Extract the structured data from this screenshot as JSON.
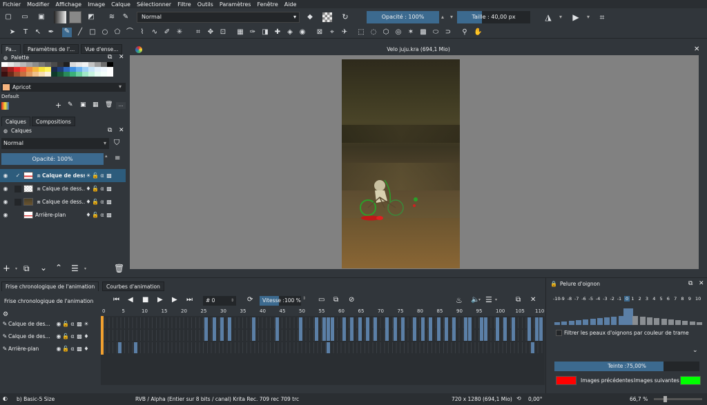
{
  "menu": [
    "Fichier",
    "Modifier",
    "Affichage",
    "Image",
    "Calque",
    "Sélectionner",
    "Filtre",
    "Outils",
    "Paramètres",
    "Fenêtre",
    "Aide"
  ],
  "toolbar": {
    "blend_mode": "Normal",
    "opacity_label": "Opacité : 100%",
    "size_label": "Taille : 40,00 px"
  },
  "left_tabs": [
    "Pa...",
    "Paramètres de l'...",
    "Vue d'ense..."
  ],
  "palette": {
    "title": "Palette",
    "selected_color_name": "Apricot",
    "selected_color": "#f6b47e",
    "set_name": "Default"
  },
  "layers_tabs": [
    "Calques",
    "Compositions"
  ],
  "layers": {
    "title": "Calques",
    "blend_mode": "Normal",
    "opacity_label": "Opacité:  100%",
    "items": [
      {
        "name": "Calque de dess..."
      },
      {
        "name": "Calque de dess..."
      },
      {
        "name": "Calque de dess..."
      },
      {
        "name": "Arrière-plan"
      }
    ]
  },
  "canvas": {
    "title": "Velo juju.kra (694,1 Mio)"
  },
  "timeline_tabs": [
    "Frise chronologique de l'animation",
    "Courbes d'animation"
  ],
  "timeline": {
    "title": "Frise chronologique de l'animation",
    "frame_label": "# 0",
    "speed_label": "Vitesse :100 %",
    "ruler": [
      "0",
      "5",
      "10",
      "15",
      "20",
      "25",
      "30",
      "35",
      "40",
      "45",
      "50",
      "55",
      "60",
      "65",
      "70",
      "75",
      "80",
      "85",
      "90",
      "95",
      "100",
      "105",
      "110"
    ],
    "rows": [
      {
        "name": "Calque de des..."
      },
      {
        "name": "Calque de des..."
      },
      {
        "name": "Arrière-plan"
      }
    ]
  },
  "onion": {
    "title": "Pelure d'oignon",
    "numbers": [
      "-10",
      "-9",
      "-8",
      "-7",
      "-6",
      "-5",
      "-4",
      "-3",
      "-2",
      "-1",
      "0",
      "1",
      "2",
      "3",
      "4",
      "5",
      "6",
      "7",
      "8",
      "9",
      "10"
    ],
    "filter_label": "Filtrer les peaux d'oignons par couleur de trame",
    "tint_label": "Teinte :75,00%",
    "tint_fraction": 0.75,
    "prev_label": "Images précédentes",
    "next_label": "Images suivantes",
    "prev_color": "#ff0000",
    "next_color": "#00ff00"
  },
  "status": {
    "brush": "b) Basic-5 Size",
    "colorspace": "RVB / Alpha (Entier sur 8 bits / canal) Krita Rec. 709 rec 709 trc",
    "dimensions": "720 x 1280 (694,1 Mio)",
    "rotation": "0,00°",
    "zoom": "66,7 %"
  }
}
